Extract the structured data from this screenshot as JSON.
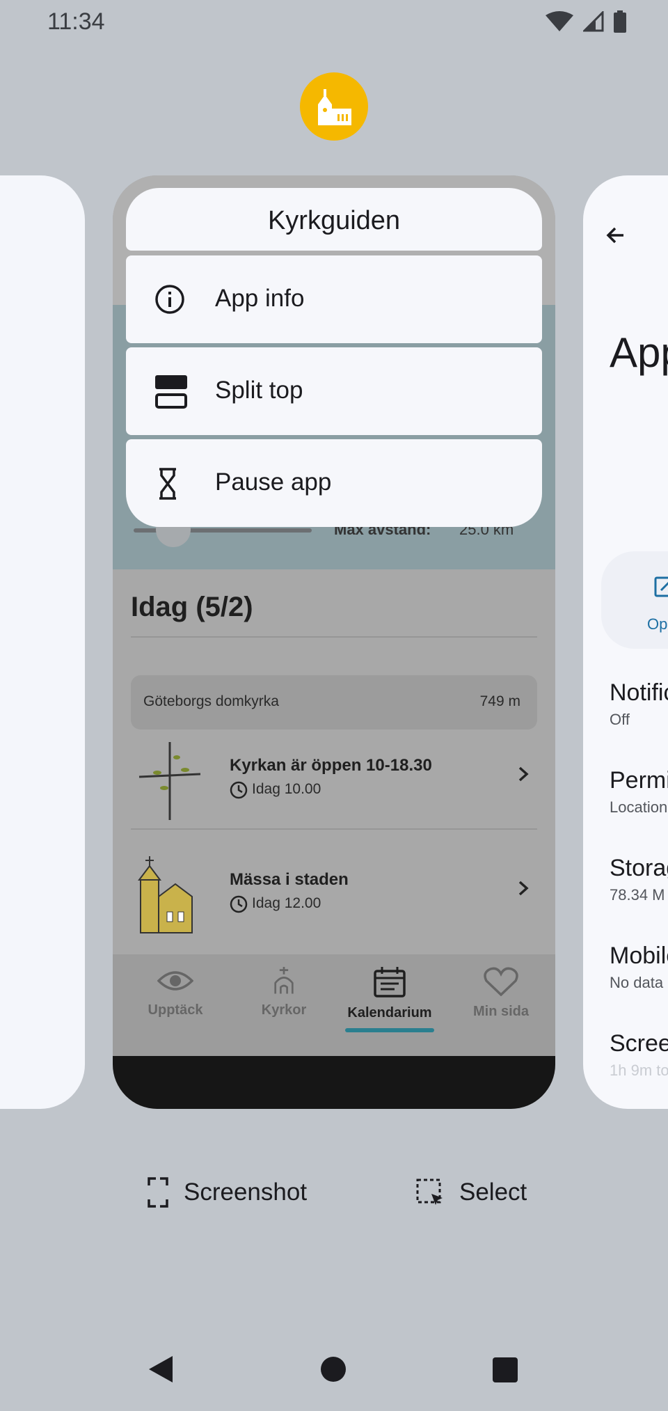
{
  "status_bar": {
    "time": "11:34"
  },
  "popup": {
    "app_name": "Kyrkguiden",
    "items": [
      {
        "label": "App info",
        "icon": "info-icon"
      },
      {
        "label": "Split top",
        "icon": "split-screen-icon"
      },
      {
        "label": "Pause app",
        "icon": "hourglass-icon"
      }
    ]
  },
  "preview": {
    "max_distance_label": "Max avstånd:",
    "max_distance_value": "25.0 km",
    "date_heading": "Idag (5/2)",
    "location_name": "Göteborgs domkyrka",
    "location_distance": "749 m",
    "events": [
      {
        "title": "Kyrkan är öppen 10-18.30",
        "time": "Idag 10.00",
        "icon": "cross-branch-icon"
      },
      {
        "title": "Mässa i staden",
        "time": "Idag 12.00",
        "icon": "church-icon"
      }
    ],
    "nav": [
      {
        "label": "Upptäck",
        "icon": "eye-icon"
      },
      {
        "label": "Kyrkor",
        "icon": "church-nav-icon"
      },
      {
        "label": "Kalendarium",
        "icon": "calendar-icon",
        "active": true
      },
      {
        "label": "Min sida",
        "icon": "heart-icon"
      }
    ]
  },
  "right_card": {
    "title_fragment": "App",
    "open_fragment": "Op",
    "rows": [
      {
        "title": "Notific",
        "subtitle": "Off"
      },
      {
        "title": "Permi",
        "subtitle": "Location"
      },
      {
        "title": "Storag",
        "subtitle": "78.34 M"
      },
      {
        "title": "Mobile",
        "subtitle": "No data"
      },
      {
        "title": "Screen",
        "subtitle": "1h 9m to"
      }
    ]
  },
  "actions": {
    "screenshot": "Screenshot",
    "select": "Select"
  },
  "colors": {
    "app_icon_bg": "#f5b800",
    "background": "#c0c5cb",
    "accent": "#2a7f8f"
  }
}
